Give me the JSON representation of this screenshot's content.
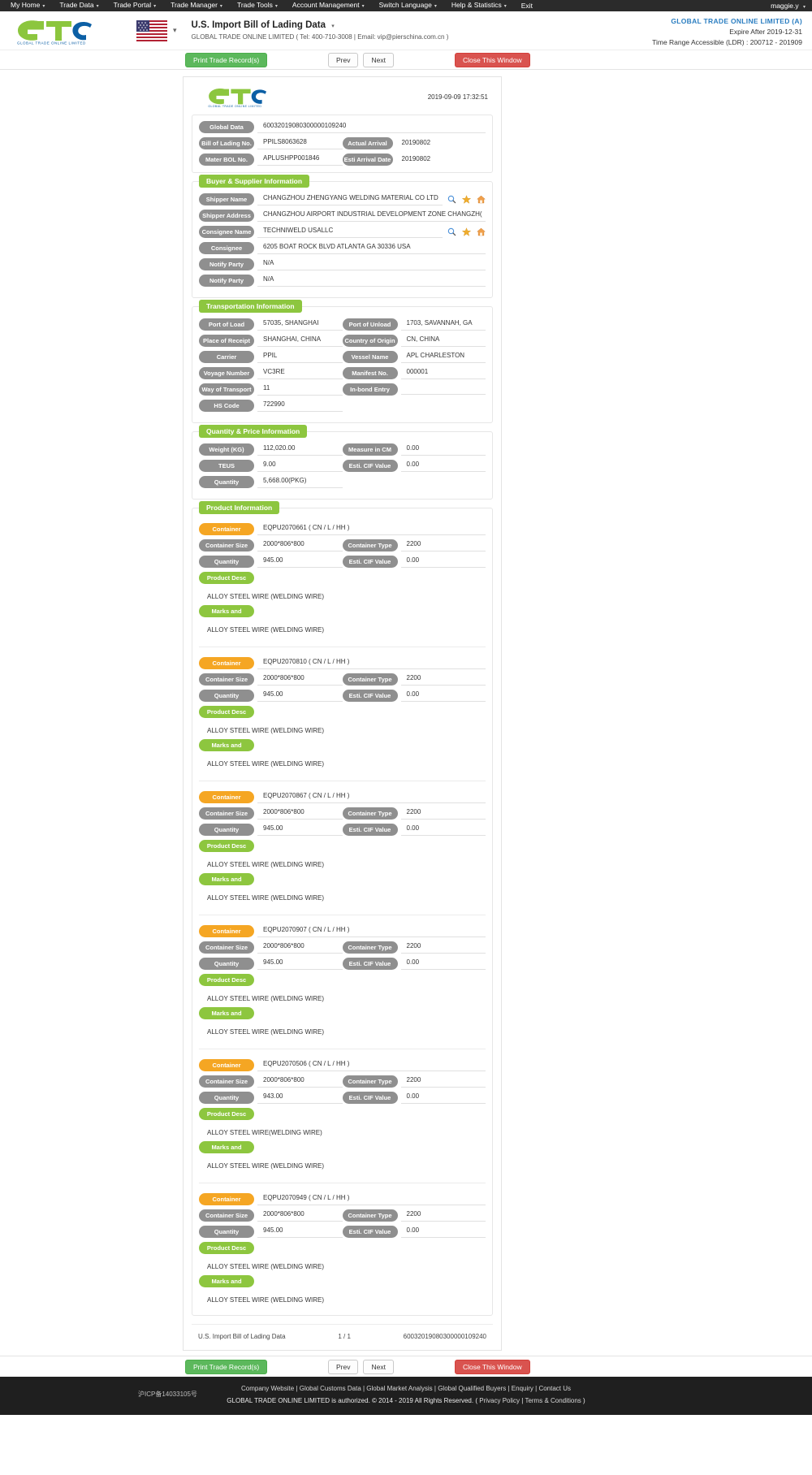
{
  "topnav": {
    "items": [
      {
        "label": "My Home",
        "caret": true
      },
      {
        "label": "Trade Data",
        "caret": true
      },
      {
        "label": "Trade Portal",
        "caret": true
      },
      {
        "label": "Trade Manager",
        "caret": true
      },
      {
        "label": "Trade Tools",
        "caret": true
      },
      {
        "label": "Account Management",
        "caret": true
      },
      {
        "label": "Switch Language",
        "caret": true
      },
      {
        "label": "Help & Statistics",
        "caret": true
      },
      {
        "label": "Exit",
        "caret": false
      }
    ],
    "user": "maggie.y",
    "user_caret": "▾"
  },
  "header": {
    "logo_text": "GLOBAL TRADE ONLINE LIMITED",
    "flag": "us-flag-icon",
    "title": "U.S. Import Bill of Lading Data",
    "title_caret": "▾",
    "subtitle": "GLOBAL TRADE ONLINE LIMITED ( Tel: 400-710-3008 | Email: vip@pierschina.com.cn )",
    "company": "GLOBAL TRADE ONLINE LIMITED (A)",
    "expire": "Expire After 2019-12-31",
    "range": "Time Range Accessible (LDR) : 200712 - 201909"
  },
  "toolbar": {
    "print_label": "Print Trade Record(s)",
    "prev_label": "Prev",
    "next_label": "Next",
    "close_label": "Close This Window"
  },
  "document": {
    "timestamp": "2019-09-09 17:32:51",
    "basic": {
      "global_data_label": "Global Data",
      "global_data_value": "60032019080300000109240",
      "bol_label": "Bill of Lading No.",
      "bol_value": "PPILS8063628",
      "actual_arrival_label": "Actual Arrival",
      "actual_arrival_value": "20190802",
      "master_bol_label": "Mater BOL No.",
      "master_bol_value": "APLUSHPP001846",
      "esti_arrival_label": "Esti Arrival Date",
      "esti_arrival_value": "20190802"
    },
    "buyer_supplier": {
      "title": "Buyer & Supplier Information",
      "rows": [
        {
          "label": "Shipper Name",
          "value": "CHANGZHOU ZHENGYANG WELDING MATERIAL CO LTD",
          "icons": true
        },
        {
          "label": "Shipper Address",
          "value": " CHANGZHOU AIRPORT INDUSTRIAL DEVELOPMENT ZONE CHANGZH(",
          "icons": false
        },
        {
          "label": "Consignee Name",
          "value": "TECHNIWELD USALLC",
          "icons": true
        },
        {
          "label": "Consignee",
          "value": "6205 BOAT ROCK BLVD ATLANTA GA 30336 USA",
          "icons": false
        },
        {
          "label": "Notify Party",
          "value": "N/A",
          "icons": false
        },
        {
          "label": "Notify Party",
          "value": "N/A",
          "icons": false
        }
      ]
    },
    "transportation": {
      "title": "Transportation Information",
      "rows": [
        [
          {
            "label": "Port of Load",
            "value": "57035, SHANGHAI"
          },
          {
            "label": "Port of Unload",
            "value": "1703, SAVANNAH, GA"
          }
        ],
        [
          {
            "label": "Place of Receipt",
            "value": "SHANGHAI, CHINA"
          },
          {
            "label": "Country of Origin",
            "value": "CN, CHINA"
          }
        ],
        [
          {
            "label": "Carrier",
            "value": "PPIL"
          },
          {
            "label": "Vessel Name",
            "value": "APL CHARLESTON"
          }
        ],
        [
          {
            "label": "Voyage Number",
            "value": "VC3RE"
          },
          {
            "label": "Manifest No.",
            "value": "000001"
          }
        ],
        [
          {
            "label": "Way of Transport",
            "value": "11"
          },
          {
            "label": "In-bond Entry",
            "value": ""
          }
        ],
        [
          {
            "label": "HS Code",
            "value": "722990"
          }
        ]
      ]
    },
    "quantity_price": {
      "title": "Quantity & Price Information",
      "rows": [
        [
          {
            "label": "Weight (KG)",
            "value": "112,020.00"
          },
          {
            "label": "Measure in CM",
            "value": "0.00"
          }
        ],
        [
          {
            "label": "TEUS",
            "value": "9.00"
          },
          {
            "label": "Esti. CIF Value",
            "value": "0.00"
          }
        ],
        [
          {
            "label": "Quantity",
            "value": "5,668.00(PKG)"
          }
        ]
      ]
    },
    "product_information": {
      "title": "Product Information",
      "labels": {
        "container": "Container",
        "container_size": "Container Size",
        "container_type": "Container Type",
        "quantity": "Quantity",
        "esti_cif": "Esti. CIF Value",
        "product_desc": "Product Desc",
        "marks": "Marks and"
      },
      "containers": [
        {
          "container": "EQPU2070661 ( CN / L / HH )",
          "size": "2000*806*800",
          "type": "2200",
          "quantity": "945.00",
          "cif": "0.00",
          "desc": "ALLOY STEEL WIRE (WELDING WIRE)",
          "marks": "ALLOY STEEL WIRE (WELDING WIRE)"
        },
        {
          "container": "EQPU2070810 ( CN / L / HH )",
          "size": "2000*806*800",
          "type": "2200",
          "quantity": "945.00",
          "cif": "0.00",
          "desc": "ALLOY STEEL WIRE (WELDING WIRE)",
          "marks": "ALLOY STEEL WIRE (WELDING WIRE)"
        },
        {
          "container": "EQPU2070867 ( CN / L / HH )",
          "size": "2000*806*800",
          "type": "2200",
          "quantity": "945.00",
          "cif": "0.00",
          "desc": "ALLOY STEEL WIRE (WELDING WIRE)",
          "marks": "ALLOY STEEL WIRE (WELDING WIRE)"
        },
        {
          "container": "EQPU2070907 ( CN / L / HH )",
          "size": "2000*806*800",
          "type": "2200",
          "quantity": "945.00",
          "cif": "0.00",
          "desc": "ALLOY STEEL WIRE (WELDING WIRE)",
          "marks": "ALLOY STEEL WIRE (WELDING WIRE)"
        },
        {
          "container": "EQPU2070506 ( CN / L / HH )",
          "size": "2000*806*800",
          "type": "2200",
          "quantity": "943.00",
          "cif": "0.00",
          "desc": "ALLOY STEEL WIRE(WELDING WIRE)",
          "marks": "ALLOY STEEL WIRE (WELDING WIRE)"
        },
        {
          "container": "EQPU2070949 ( CN / L / HH )",
          "size": "2000*806*800",
          "type": "2200",
          "quantity": "945.00",
          "cif": "0.00",
          "desc": "ALLOY STEEL WIRE (WELDING WIRE)",
          "marks": "ALLOY STEEL WIRE (WELDING WIRE)"
        }
      ]
    },
    "footer": {
      "left": "U.S. Import Bill of Lading Data",
      "center": "1 / 1",
      "right": "60032019080300000109240"
    }
  },
  "site_footer": {
    "links": [
      "Company Website",
      "Global Customs Data",
      "Global Market Analysis",
      "Global Qualified Buyers",
      "Enquiry",
      "Contact Us"
    ],
    "copyright": "GLOBAL TRADE ONLINE LIMITED is authorized. © 2014 - 2019 All Rights Reserved.",
    "legal_open": "(",
    "privacy": "Privacy Policy",
    "terms": "Terms & Conditions",
    "legal_close": ")",
    "icp": "沪ICP备14033105号"
  },
  "colors": {
    "green": "#8dc63f",
    "orange": "#f5a623",
    "grey_label": "#8f8f8f",
    "red": "#d9534f",
    "blue": "#2b7ec1"
  }
}
